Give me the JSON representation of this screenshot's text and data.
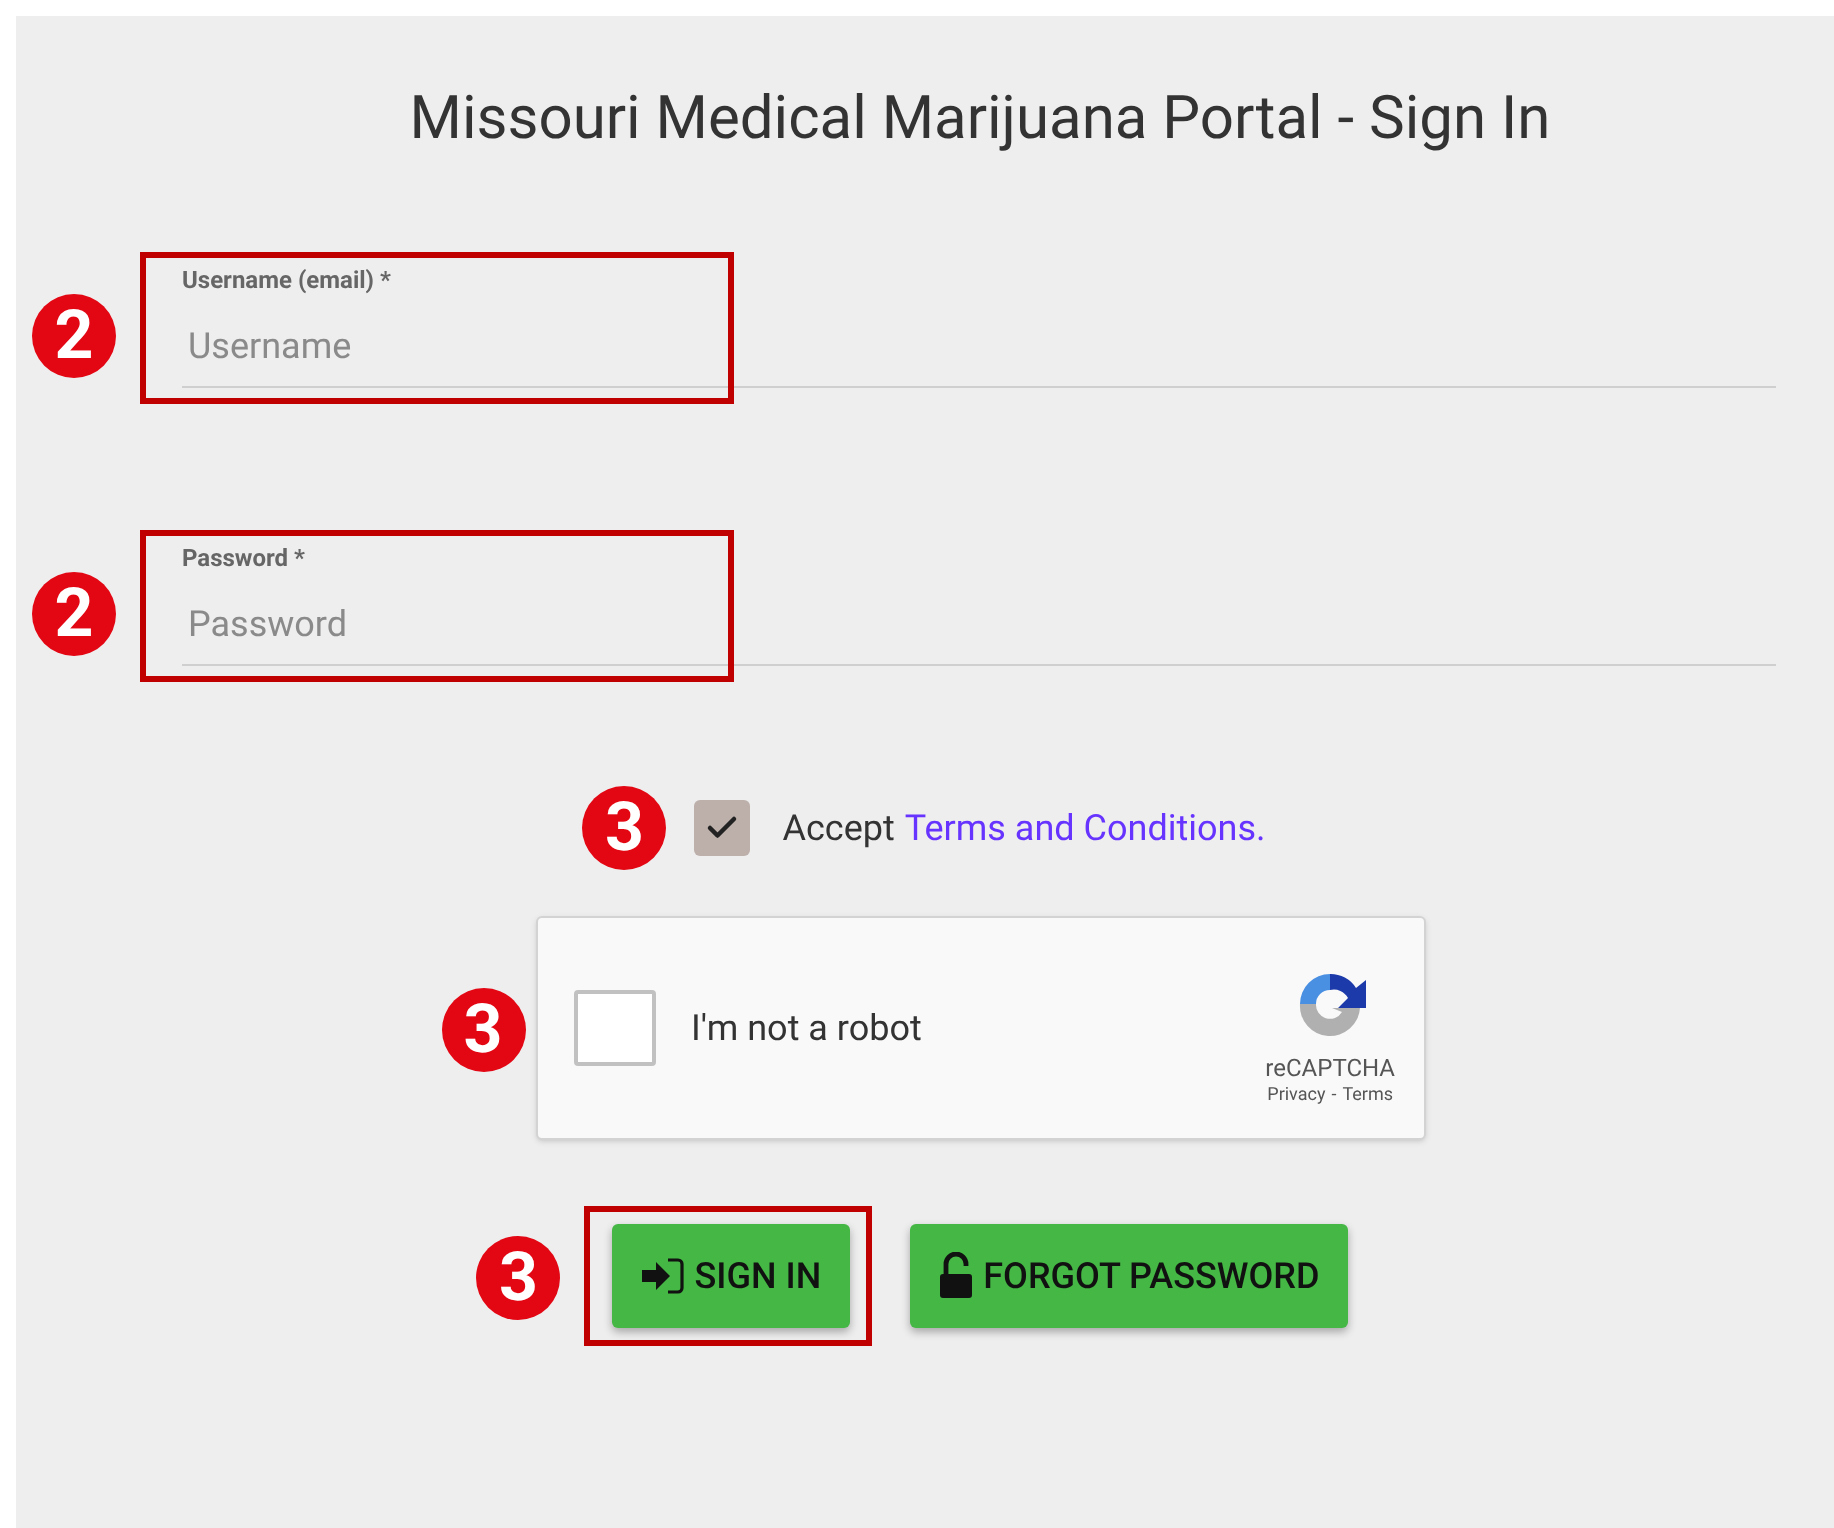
{
  "title": "Missouri Medical Marijuana Portal - Sign In",
  "fields": [
    {
      "label": "Username (email) *",
      "placeholder": "Username",
      "highlighted": true,
      "marker": "2"
    },
    {
      "label": "Password *",
      "placeholder": "Password",
      "highlighted": true,
      "marker": "2"
    }
  ],
  "terms": {
    "checked": true,
    "prefix": "Accept",
    "link": "Terms and Conditions.",
    "marker": "3"
  },
  "captcha": {
    "checked": false,
    "label": "I'm not a robot",
    "brand": "reCAPTCHA",
    "privacy": "Privacy",
    "separator": "-",
    "terms": "Terms",
    "marker": "3"
  },
  "buttons": [
    {
      "kind": "sign-in",
      "label": "SIGN IN",
      "highlighted": true,
      "marker": "3"
    },
    {
      "kind": "forgot",
      "label": "FORGOT PASSWORD",
      "highlighted": false
    }
  ]
}
